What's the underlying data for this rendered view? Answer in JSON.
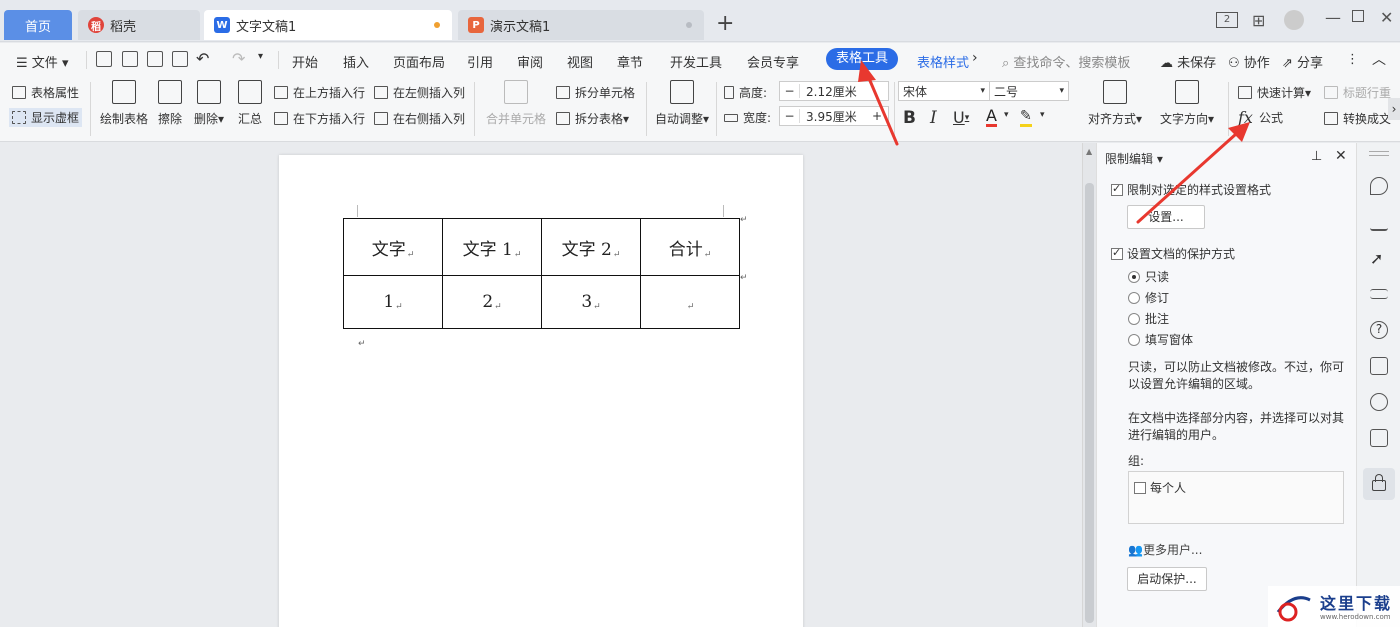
{
  "tabs": {
    "home": "首页",
    "daoke": "稻壳",
    "doc": "文字文稿1",
    "ppt": "演示文稿1"
  },
  "menu": {
    "file": "文件",
    "items": [
      "开始",
      "插入",
      "页面布局",
      "引用",
      "审阅",
      "视图",
      "章节",
      "开发工具",
      "会员专享"
    ],
    "table_tools": "表格工具",
    "table_style": "表格样式",
    "search": "查找命令、搜索模板",
    "unsaved": "未保存",
    "collab": "协作",
    "share": "分享"
  },
  "ribbon": {
    "table_props": "表格属性",
    "show_gridlines": "显示虚框",
    "draw_table": "绘制表格",
    "erase": "擦除",
    "delete": "删除",
    "summary": "汇总",
    "insert_row_above": "在上方插入行",
    "insert_row_below": "在下方插入行",
    "insert_col_left": "在左侧插入列",
    "insert_col_right": "在右侧插入列",
    "merge_cells": "合并单元格",
    "split_cells": "拆分单元格",
    "split_table": "拆分表格",
    "auto_fit": "自动调整",
    "height_label": "高度:",
    "height_value": "2.12厘米",
    "width_label": "宽度:",
    "width_value": "3.95厘米",
    "font": "宋体",
    "font_size": "二号",
    "align": "对齐方式",
    "text_dir": "文字方向",
    "quick_calc": "快速计算",
    "title_row": "标题行重",
    "formula": "公式",
    "convert": "转换成文"
  },
  "table": {
    "rows": [
      [
        "文字",
        "文字 1",
        "文字 2",
        "合计"
      ],
      [
        "1",
        "2",
        "3",
        ""
      ]
    ]
  },
  "panel": {
    "title": "限制编辑",
    "opt1": "限制对选定的样式设置格式",
    "settings_btn": "设置...",
    "opt2": "设置文档的保护方式",
    "radios": [
      "只读",
      "修订",
      "批注",
      "填写窗体"
    ],
    "desc1_line1": "只读，可以防止文档被修改。不过，你可",
    "desc1_line2": "以设置允许编辑的区域。",
    "desc2_line1": "在文档中选择部分内容，并选择可以对其",
    "desc2_line2": "进行编辑的用户。",
    "group_label": "组:",
    "everyone": "每个人",
    "more_users": "更多用户...",
    "start_protect": "启动保护..."
  },
  "watermark": {
    "text": "这里下载",
    "url": "www.herodown.com"
  },
  "colors": {
    "accent": "#2b6ce6",
    "home_tab": "#5b8fe6",
    "arrow": "#e8382f"
  }
}
